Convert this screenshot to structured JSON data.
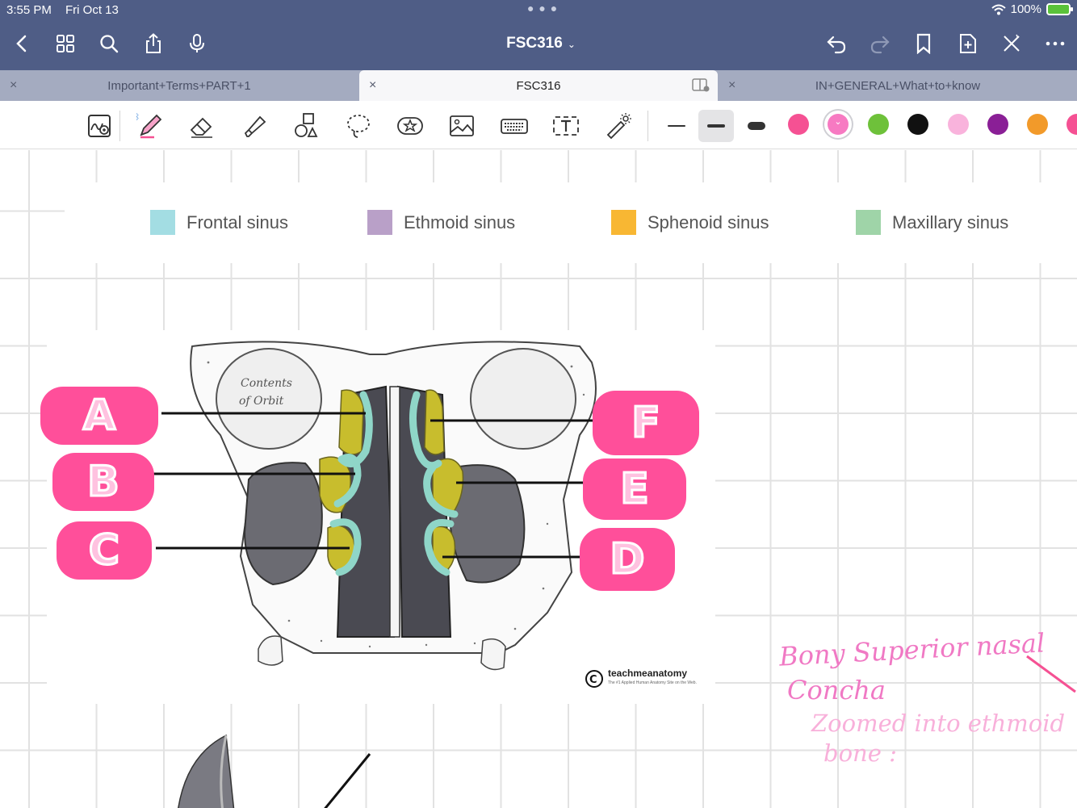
{
  "status": {
    "time": "3:55 PM",
    "date": "Fri Oct 13",
    "battery": "100%"
  },
  "nav": {
    "title": "FSC316",
    "icons": [
      "back-icon",
      "grid-icon",
      "search-icon",
      "share-icon",
      "microphone-icon",
      "undo-icon",
      "redo-icon",
      "bookmark-icon",
      "add-page-icon",
      "close-edit-icon",
      "more-icon"
    ]
  },
  "tabs": [
    {
      "label": "Important+Terms+PART+1",
      "active": false
    },
    {
      "label": "FSC316",
      "active": true
    },
    {
      "label": "IN+GENERAL+What+to+know",
      "active": false
    }
  ],
  "toolbar": {
    "tools": [
      "handwriting-zoom",
      "pen",
      "eraser",
      "highlighter",
      "shapes",
      "lasso",
      "elements",
      "image",
      "keyboard",
      "text",
      "laser-pointer"
    ],
    "colors": [
      "#f55193",
      "#f77ac2",
      "#6ec13a",
      "#111111",
      "#f9b3dc",
      "#8a1f96",
      "#f29a2a"
    ],
    "selected_color": "#f77ac2"
  },
  "legend": [
    {
      "label": "Frontal sinus",
      "color": "#a3dde3"
    },
    {
      "label": "Ethmoid sinus",
      "color": "#b9a0c8"
    },
    {
      "label": "Sphenoid sinus",
      "color": "#f8b733"
    },
    {
      "label": "Maxillary sinus",
      "color": "#9fd4a8"
    }
  ],
  "figure": {
    "orbit_text_1": "Contents",
    "orbit_text_2": "of Orbit",
    "credit": "teachmeanatomy",
    "credit_sub": "The #1 Applied Human Anatomy Site on the Web."
  },
  "labels": {
    "a": "A",
    "b": "B",
    "c": "C",
    "d": "D",
    "e": "E",
    "f": "F"
  },
  "notes": {
    "line1": "Bony Superior nasal",
    "line2": "Concha",
    "line3": "Zoomed into ethmoid",
    "line4": "bone :"
  }
}
